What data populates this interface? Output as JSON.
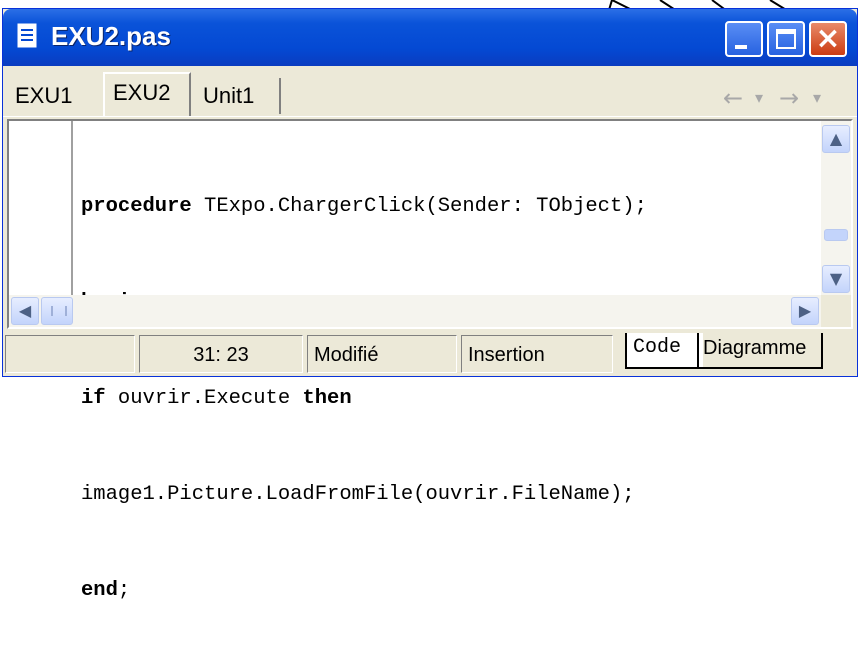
{
  "window": {
    "title": "EXU2.pas",
    "buttons": {
      "minimize": "minimize",
      "maximize": "maximize",
      "close": "close"
    }
  },
  "tabs": [
    {
      "label": "EXU1",
      "active": false
    },
    {
      "label": "EXU2",
      "active": true
    },
    {
      "label": "Unit1",
      "active": false
    }
  ],
  "nav": {
    "back": "←",
    "back_drop": "▾",
    "forward": "→",
    "forward_drop": "▾"
  },
  "code": {
    "lines": [
      {
        "kw": "procedure",
        "rest": " TExpo.ChargerClick(Sender: TObject);"
      },
      {
        "kw": "begin",
        "rest": ""
      },
      {
        "kw": "if",
        "rest": " ouvrir.Execute ",
        "kw2": "then"
      },
      {
        "kw": "",
        "rest": "image1.Picture.LoadFromFile(ouvrir.FileName);"
      },
      {
        "kw": "end",
        "rest": ";"
      }
    ]
  },
  "status": {
    "position": "31:  23",
    "modified": "Modifié",
    "mode": "Insertion"
  },
  "bottom_tabs": {
    "code": "Code",
    "diagram": "Diagramme"
  },
  "colors": {
    "titlebar": "#0449d3",
    "close_button": "#cc3c12",
    "chrome": "#ece9d8"
  },
  "icons": [
    "file-icon",
    "minimize-icon",
    "maximize-icon",
    "close-icon",
    "arrow-up-icon",
    "arrow-down-icon",
    "arrow-left-icon",
    "arrow-right-icon"
  ]
}
